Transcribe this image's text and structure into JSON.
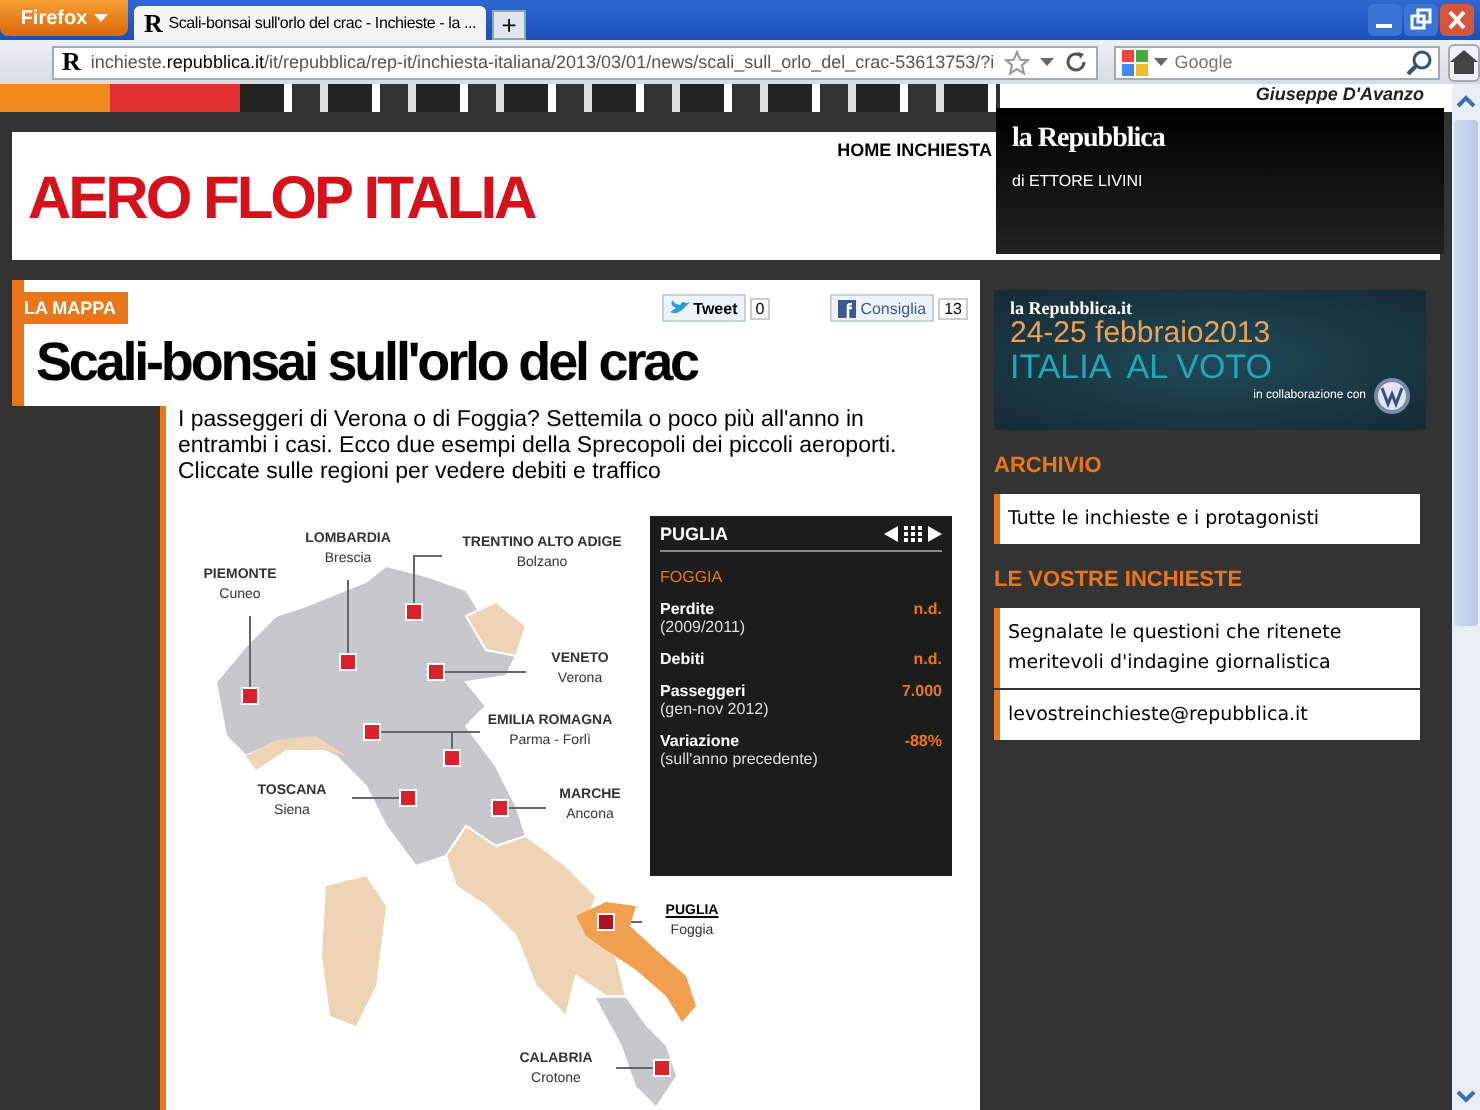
{
  "browser": {
    "menu_button": "Firefox",
    "tab_icon": "R",
    "url_icon": "R",
    "tab_title": "Scali-bonsai sull'orlo del crac - Inchieste - la ...",
    "new_tab": "+",
    "url_host": "inchieste.",
    "url_domain": "repubblica.it",
    "url_path": "/it/repubblica/rep-it/inchiesta-italiana/2013/03/01/news/scali_sull_orlo_del_crac-53613753/?i",
    "search_placeholder": "Google"
  },
  "banner": {
    "author": "Giuseppe D'Avanzo"
  },
  "header": {
    "title": "AERO FLOP ITALIA",
    "home_link": "HOME INCHIESTA",
    "brand": "la Repubblica",
    "byline": "di ETTORE LIVINI"
  },
  "article": {
    "tag": "LA MAPPA",
    "tweet": {
      "label": "Tweet",
      "count": "0"
    },
    "like": {
      "label": "Consiglia",
      "count": "13"
    },
    "title": "Scali-bonsai sull'orlo del crac",
    "intro": "I passeggeri di Verona o di Foggia? Settemila o poco più all'anno in entrambi i casi. Ecco due esempi della Sprecopoli dei piccoli aeroporti. Cliccate sulle regioni per vedere debiti e traffico"
  },
  "map": {
    "regions": [
      {
        "name": "PIEMONTE",
        "city": "Cuneo",
        "selected": false
      },
      {
        "name": "LOMBARDIA",
        "city": "Brescia",
        "selected": false
      },
      {
        "name": "TRENTINO ALTO ADIGE",
        "city": "Bolzano",
        "selected": false
      },
      {
        "name": "VENETO",
        "city": "Verona",
        "selected": false
      },
      {
        "name": "EMILIA ROMAGNA",
        "city": "Parma - Forlì",
        "selected": false
      },
      {
        "name": "TOSCANA",
        "city": "Siena",
        "selected": false
      },
      {
        "name": "MARCHE",
        "city": "Ancona",
        "selected": false
      },
      {
        "name": "PUGLIA",
        "city": "Foggia",
        "selected": true
      },
      {
        "name": "CALABRIA",
        "city": "Crotone",
        "selected": false
      }
    ],
    "panel": {
      "region": "PUGLIA",
      "city": "FOGGIA",
      "stats": [
        {
          "label": "Perdite",
          "note": "(2009/2011)",
          "value": "n.d."
        },
        {
          "label": "Debiti",
          "value": "n.d."
        },
        {
          "label": "Passeggeri",
          "note": "(gen-nov 2012)",
          "value": "7.000"
        },
        {
          "label": "Variazione",
          "note": "(sull'anno precedente)",
          "value": "-88%"
        }
      ]
    }
  },
  "sidebar": {
    "promo": {
      "brand": "la Repubblica.it",
      "dates": "24-25 febbraio2013",
      "headline": "ITALIA  AL VOTO",
      "sponsor": "in collaborazione con"
    },
    "sections": [
      {
        "heading": "ARCHIVIO",
        "links": [
          "Tutte le inchieste e i protagonisti"
        ]
      },
      {
        "heading": "LE VOSTRE INCHIESTE",
        "links": [
          "Segnalate le questioni che ritenete meritevoli d'indagine giornalistica",
          "levostreinchieste@repubblica.it"
        ]
      }
    ]
  }
}
